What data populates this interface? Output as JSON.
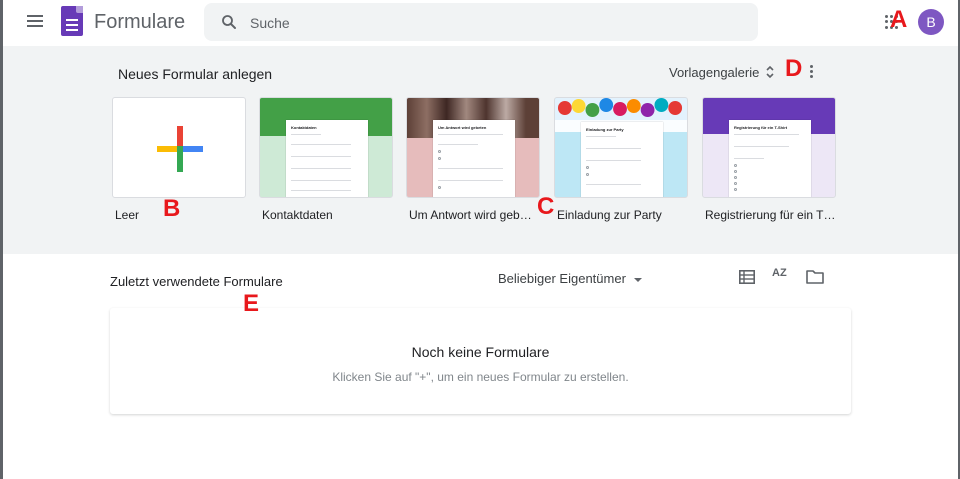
{
  "header": {
    "app_title": "Formulare",
    "search_placeholder": "Suche",
    "avatar_initial": "B",
    "menu_icon": "hamburger-menu-icon",
    "apps_icon": "apps-grid-icon",
    "logo_icon": "forms-logo-icon"
  },
  "annotations": {
    "a": "A",
    "b": "B",
    "c": "C",
    "d": "D",
    "e": "E",
    "color": "#e8181c"
  },
  "templates": {
    "section_title": "Neues Formular anlegen",
    "gallery_label": "Vorlagengalerie",
    "cards": [
      {
        "label": "Leer",
        "preview_title": "",
        "accent": "#ffffff"
      },
      {
        "label": "Kontaktdaten",
        "preview_title": "Kontaktdaten",
        "accent": "#43a047"
      },
      {
        "label": "Um Antwort wird geb…",
        "preview_title": "Um Antwort wird gebeten",
        "accent": "#e6bcbc"
      },
      {
        "label": "Einladung zur Party",
        "preview_title": "Einladung zur Party",
        "accent": "#bde7f5"
      },
      {
        "label": "Registrierung für ein T…",
        "preview_title": "Registrierung für ein T-Shirt",
        "accent": "#673ab7"
      }
    ]
  },
  "recent": {
    "title": "Zuletzt verwendete Formulare",
    "owner_filter": "Beliebiger Eigentümer",
    "sort_label": "AZ",
    "empty_title": "Noch keine Formulare",
    "empty_hint": "Klicken Sie auf \"+\", um ein neues Formular zu erstellen."
  },
  "colors": {
    "brand": "#673ab7",
    "section_bg": "#f1f3f4",
    "avatar": "#7e57c2"
  }
}
